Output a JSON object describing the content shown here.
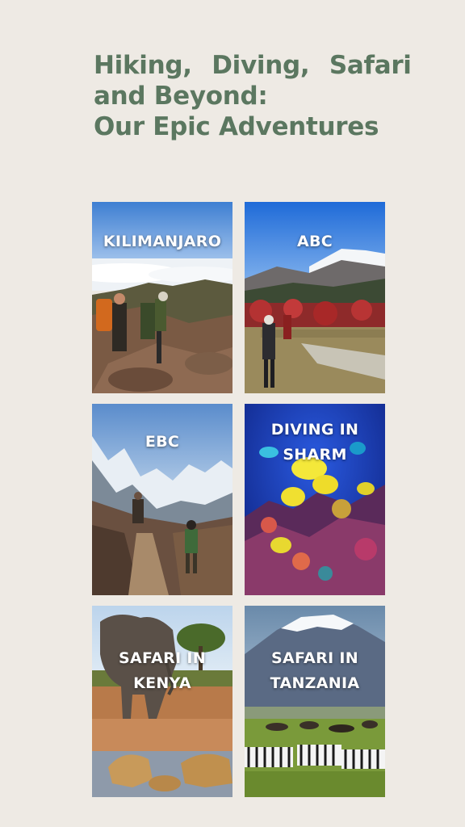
{
  "heading": {
    "line1": "Hiking,  Diving,  Safari",
    "line2": "and Beyond:",
    "line3": "Our Epic Adventures"
  },
  "cards": [
    {
      "line1": "KILIMANJARO",
      "line2": ""
    },
    {
      "line1": "ABC",
      "line2": ""
    },
    {
      "line1": "EBC",
      "line2": ""
    },
    {
      "line1": "DIVING IN",
      "line2": "SHARM"
    },
    {
      "line1": "SAFARI IN",
      "line2": "KENYA"
    },
    {
      "line1": "SAFARI IN",
      "line2": "TANZANIA"
    }
  ],
  "colors": {
    "background": "#eeeae4",
    "heading": "#5b7760",
    "label": "#ffffff"
  }
}
